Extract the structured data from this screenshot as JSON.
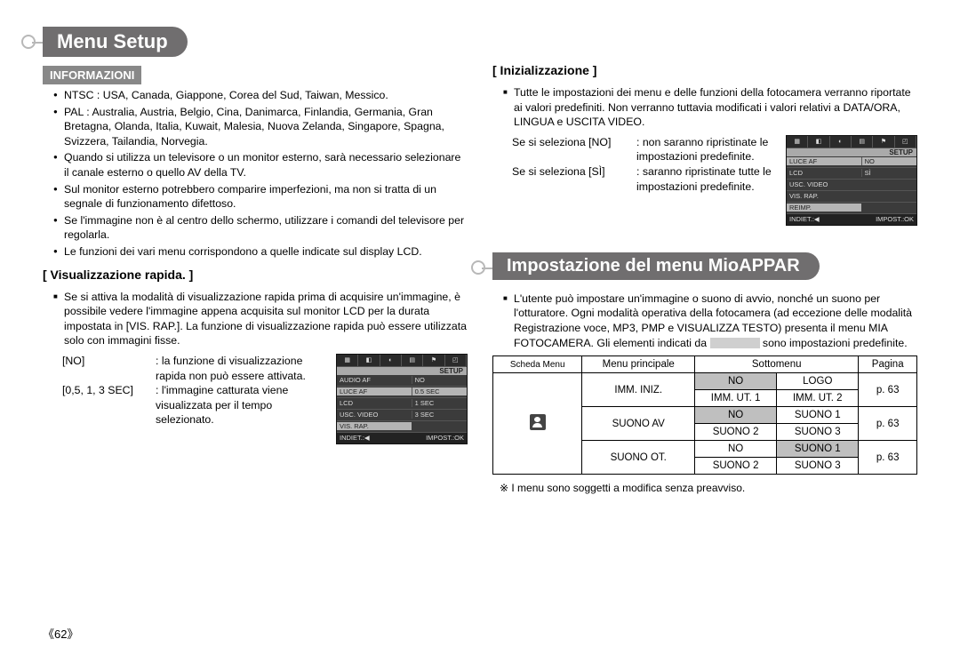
{
  "pageNumber": "《62》",
  "left": {
    "title": "Menu Setup",
    "infoLabel": "INFORMAZIONI",
    "infoItems": [
      "NTSC : USA, Canada, Giappone, Corea del Sud, Taiwan, Messico.",
      "PAL : Australia, Austria, Belgio, Cina, Danimarca, Finlandia,  Germania, Gran Bretagna, Olanda, Italia, Kuwait, Malesia, Nuova Zelanda, Singapore, Spagna, Svizzera, Tailandia, Norvegia.",
      "Quando si utilizza un televisore o un monitor esterno, sarà necessario selezionare il canale esterno o quello AV della TV.",
      "Sul monitor esterno potrebbero comparire imperfezioni, ma non si tratta di un segnale di funzionamento difettoso.",
      "Se l'immagine non è al centro dello schermo, utilizzare i comandi del televisore per regolarla.",
      "Le funzioni dei vari menu corrispondono a quelle indicate sul display LCD."
    ],
    "quickView": {
      "heading": "[ Visualizzazione rapida. ]",
      "intro": "Se si attiva la modalità di visualizzazione rapida prima di acquisire un'immagine, è possibile vedere l'immagine appena acquisita sul monitor LCD per la durata impostata in [VIS. RAP.]. La funzione di visualizzazione rapida può essere utilizzata solo con immagini fisse.",
      "rows": [
        {
          "k": "[NO]",
          "v": ": la funzione di visualizzazione rapida non può essere attivata."
        },
        {
          "k": "[0,5, 1, 3 SEC]",
          "v": ": l'immagine catturata viene visualizzata per il tempo selezionato."
        }
      ],
      "screen": {
        "setup": "SETUP",
        "rows": [
          {
            "l": "AUDIO AF",
            "r": "NO"
          },
          {
            "l": "LUCE AF",
            "r": "0.5 SEC"
          },
          {
            "l": "LCD",
            "r": "1 SEC"
          },
          {
            "l": "USC. VIDEO",
            "r": "3 SEC"
          },
          {
            "l": "VIS. RAP.",
            "r": ""
          }
        ],
        "footL": "INDIET.:◀",
        "footR": "IMPOST.:OK"
      }
    }
  },
  "right": {
    "init": {
      "heading": "[ Inizializzazione ]",
      "intro": "Tutte le impostazioni dei menu e delle funzioni della fotocamera verranno riportate ai valori predefiniti. Non verranno tuttavia modificati i valori relativi a DATA/ORA, LINGUA e USCITA VIDEO.",
      "selNo": {
        "k": "Se si seleziona [NO]",
        "v": ": non saranno ripristinate le impostazioni predefinite."
      },
      "selSi": {
        "k": "Se si seleziona [SÌ]",
        "v": ": saranno ripristinate tutte le impostazioni predefinite."
      },
      "screen": {
        "setup": "SETUP",
        "rows": [
          {
            "l": "LUCE AF",
            "r": "NO"
          },
          {
            "l": "LCD",
            "r": "SÌ"
          },
          {
            "l": "USC. VIDEO",
            "r": ""
          },
          {
            "l": "VIS. RAP.",
            "r": ""
          },
          {
            "l": "REIMP.",
            "r": ""
          }
        ],
        "footL": "INDIET.:◀",
        "footR": "IMPOST.:OK"
      }
    },
    "title2": "Impostazione del menu MioAPPAR",
    "mycamIntro": "L'utente può impostare un'immagine o suono di avvio, nonché un suono per l'otturatore. Ogni modalità operativa della fotocamera (ad eccezione delle modalità Registrazione voce, MP3, PMP e VISUALIZZA TESTO) presenta il menu MIA FOTOCAMERA. Gli elementi indicati da ",
    "mycamIntroTail": " sono impostazioni predefinite.",
    "tableHead": {
      "c1": "Scheda Menu",
      "c2": "Menu principale",
      "c3": "Sottomenu",
      "c4": "Pagina"
    },
    "table": {
      "mainMenus": [
        "IMM. INIZ.",
        "SUONO AV",
        "SUONO OT."
      ],
      "rows": [
        {
          "shade1": true,
          "s1": "NO",
          "s2": "LOGO",
          "page": "p. 63"
        },
        {
          "s1": "IMM. UT. 1",
          "s2": "IMM. UT. 2"
        },
        {
          "shade1": true,
          "s1": "NO",
          "s2": "SUONO 1",
          "page": "p. 63"
        },
        {
          "s1": "SUONO 2",
          "s2": "SUONO 3"
        },
        {
          "s1": "NO",
          "shade2": true,
          "s2": "SUONO 1",
          "page": "p. 63"
        },
        {
          "s1": "SUONO 2",
          "s2": "SUONO 3"
        }
      ]
    },
    "footnote": "※ I menu sono soggetti a modifica senza preavviso."
  }
}
